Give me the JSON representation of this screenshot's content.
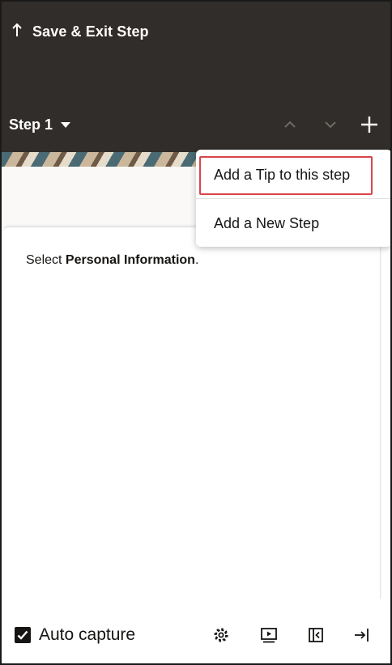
{
  "header": {
    "save_exit_label": "Save & Exit Step",
    "step_label": "Step 1"
  },
  "menu": {
    "items": [
      {
        "label": "Add a Tip to this step"
      },
      {
        "label": "Add a New Step"
      }
    ]
  },
  "content": {
    "instruction_prefix": "Select ",
    "instruction_bold": "Personal Information",
    "instruction_suffix": "."
  },
  "footer": {
    "auto_capture_label": "Auto capture",
    "auto_capture_checked": true
  },
  "colors": {
    "header_bg": "#312d2a",
    "highlight_border": "#d9454a"
  },
  "icons": {
    "save_exit": "up-arrow-icon",
    "step_caret": "caret-down-icon",
    "prev": "chevron-up-icon",
    "next": "chevron-down-icon",
    "add": "plus-icon",
    "settings": "gear-icon",
    "preview": "preview-icon",
    "collapse": "collapse-panel-icon",
    "exit": "exit-icon"
  }
}
